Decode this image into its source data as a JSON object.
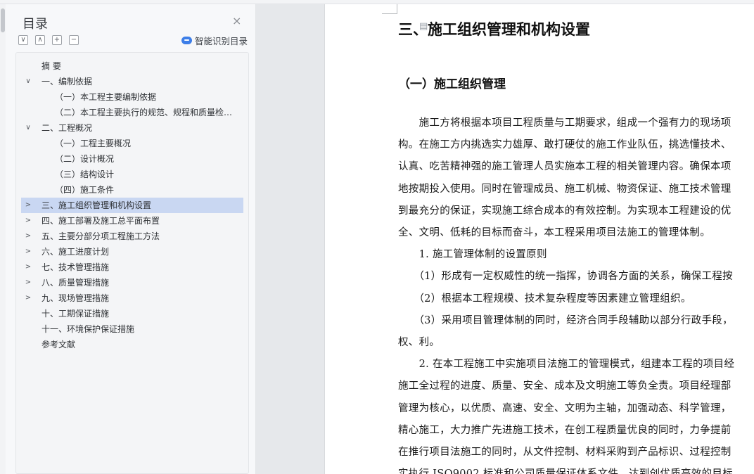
{
  "toc": {
    "title": "目录",
    "close_icon": "×",
    "tools": [
      "∨",
      "∧",
      "+",
      "−"
    ],
    "smart_label": "智能识别目录",
    "items": [
      {
        "label": "摘  要",
        "level": 1,
        "arrow": ""
      },
      {
        "label": "一、编制依据",
        "level": 1,
        "arrow": "∨"
      },
      {
        "label": "（一）本工程主要编制依据",
        "level": 2,
        "arrow": ""
      },
      {
        "label": "（二）本工程主要执行的规范、规程和质量检验 ...",
        "level": 2,
        "arrow": ""
      },
      {
        "label": "二、工程概况",
        "level": 1,
        "arrow": "∨"
      },
      {
        "label": "（一）工程主要概况",
        "level": 2,
        "arrow": ""
      },
      {
        "label": "（二）设计概况",
        "level": 2,
        "arrow": ""
      },
      {
        "label": "（三）结构设计",
        "level": 2,
        "arrow": ""
      },
      {
        "label": "（四）施工条件",
        "level": 2,
        "arrow": ""
      },
      {
        "label": "三、施工组织管理和机构设置",
        "level": 1,
        "arrow": ">",
        "selected": true
      },
      {
        "label": "四、施工部署及施工总平面布置",
        "level": 1,
        "arrow": ">"
      },
      {
        "label": "五、主要分部分项工程施工方法",
        "level": 1,
        "arrow": ">"
      },
      {
        "label": "六、施工进度计划",
        "level": 1,
        "arrow": ">"
      },
      {
        "label": "七、技术管理措施",
        "level": 1,
        "arrow": ">"
      },
      {
        "label": "八、质量管理措施",
        "level": 1,
        "arrow": ">"
      },
      {
        "label": "九、现场管理措施",
        "level": 1,
        "arrow": ">"
      },
      {
        "label": "十、工期保证措施",
        "level": 1,
        "arrow": ""
      },
      {
        "label": "十一、环境保护保证措施",
        "level": 1,
        "arrow": ""
      },
      {
        "label": "参考文献",
        "level": 1,
        "arrow": ""
      }
    ]
  },
  "document": {
    "heading1": "三、施工组织管理和机构设置",
    "heading2": "（一）施工组织管理",
    "lines": [
      "　　施工方将根据本项目工程质量与工期要求，组成一个强有力的现场项",
      "构。在施工方内挑选实力雄厚、敢打硬仗的施工作业队伍，挑选懂技术、",
      "认真、吃苦精神强的施工管理人员实施本工程的相关管理内容。确保本项",
      "地按期投入使用。同时在管理成员、施工机械、物资保证、施工技术管理",
      "到最充分的保证，实现施工综合成本的有效控制。为实现本工程建设的优",
      "全、文明、低耗的目标而奋斗，本工程采用项目法施工的管理体制。",
      "　　1. 施工管理体制的设置原则",
      "　　（1）形成有一定权威性的统一指挥，协调各方面的关系，确保工程按",
      "　　（2）根据本工程规模、技术复杂程度等因素建立管理组织。",
      "　　（3）采用项目管理体制的同时，经济合同手段辅助以部分行政手段，",
      "权、利。",
      "　　2. 在本工程施工中实施项目法施工的管理模式，组建本工程的项目经",
      "施工全过程的进度、质量、安全、成本及文明施工等负全责。项目经理部",
      "管理为核心，以优质、高速、安全、文明为主轴，加强动态、科学管理，",
      "精心施工，大力推广先进施工技术，在创工程质量优良的同时，力争提前",
      "在推行项目法施工的同时，从文件控制、材料采购到产品标识、过程控制",
      "实执行 ISO9002 标准和公司质量保证体系文件，达到创优质高效的目标"
    ]
  }
}
